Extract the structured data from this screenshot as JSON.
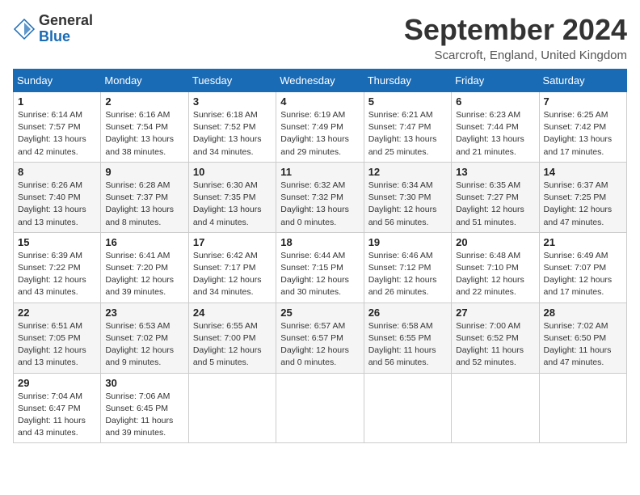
{
  "header": {
    "logo_general": "General",
    "logo_blue": "Blue",
    "month_title": "September 2024",
    "location": "Scarcroft, England, United Kingdom"
  },
  "days_of_week": [
    "Sunday",
    "Monday",
    "Tuesday",
    "Wednesday",
    "Thursday",
    "Friday",
    "Saturday"
  ],
  "weeks": [
    [
      {
        "day": "1",
        "detail": "Sunrise: 6:14 AM\nSunset: 7:57 PM\nDaylight: 13 hours\nand 42 minutes."
      },
      {
        "day": "2",
        "detail": "Sunrise: 6:16 AM\nSunset: 7:54 PM\nDaylight: 13 hours\nand 38 minutes."
      },
      {
        "day": "3",
        "detail": "Sunrise: 6:18 AM\nSunset: 7:52 PM\nDaylight: 13 hours\nand 34 minutes."
      },
      {
        "day": "4",
        "detail": "Sunrise: 6:19 AM\nSunset: 7:49 PM\nDaylight: 13 hours\nand 29 minutes."
      },
      {
        "day": "5",
        "detail": "Sunrise: 6:21 AM\nSunset: 7:47 PM\nDaylight: 13 hours\nand 25 minutes."
      },
      {
        "day": "6",
        "detail": "Sunrise: 6:23 AM\nSunset: 7:44 PM\nDaylight: 13 hours\nand 21 minutes."
      },
      {
        "day": "7",
        "detail": "Sunrise: 6:25 AM\nSunset: 7:42 PM\nDaylight: 13 hours\nand 17 minutes."
      }
    ],
    [
      {
        "day": "8",
        "detail": "Sunrise: 6:26 AM\nSunset: 7:40 PM\nDaylight: 13 hours\nand 13 minutes."
      },
      {
        "day": "9",
        "detail": "Sunrise: 6:28 AM\nSunset: 7:37 PM\nDaylight: 13 hours\nand 8 minutes."
      },
      {
        "day": "10",
        "detail": "Sunrise: 6:30 AM\nSunset: 7:35 PM\nDaylight: 13 hours\nand 4 minutes."
      },
      {
        "day": "11",
        "detail": "Sunrise: 6:32 AM\nSunset: 7:32 PM\nDaylight: 13 hours\nand 0 minutes."
      },
      {
        "day": "12",
        "detail": "Sunrise: 6:34 AM\nSunset: 7:30 PM\nDaylight: 12 hours\nand 56 minutes."
      },
      {
        "day": "13",
        "detail": "Sunrise: 6:35 AM\nSunset: 7:27 PM\nDaylight: 12 hours\nand 51 minutes."
      },
      {
        "day": "14",
        "detail": "Sunrise: 6:37 AM\nSunset: 7:25 PM\nDaylight: 12 hours\nand 47 minutes."
      }
    ],
    [
      {
        "day": "15",
        "detail": "Sunrise: 6:39 AM\nSunset: 7:22 PM\nDaylight: 12 hours\nand 43 minutes."
      },
      {
        "day": "16",
        "detail": "Sunrise: 6:41 AM\nSunset: 7:20 PM\nDaylight: 12 hours\nand 39 minutes."
      },
      {
        "day": "17",
        "detail": "Sunrise: 6:42 AM\nSunset: 7:17 PM\nDaylight: 12 hours\nand 34 minutes."
      },
      {
        "day": "18",
        "detail": "Sunrise: 6:44 AM\nSunset: 7:15 PM\nDaylight: 12 hours\nand 30 minutes."
      },
      {
        "day": "19",
        "detail": "Sunrise: 6:46 AM\nSunset: 7:12 PM\nDaylight: 12 hours\nand 26 minutes."
      },
      {
        "day": "20",
        "detail": "Sunrise: 6:48 AM\nSunset: 7:10 PM\nDaylight: 12 hours\nand 22 minutes."
      },
      {
        "day": "21",
        "detail": "Sunrise: 6:49 AM\nSunset: 7:07 PM\nDaylight: 12 hours\nand 17 minutes."
      }
    ],
    [
      {
        "day": "22",
        "detail": "Sunrise: 6:51 AM\nSunset: 7:05 PM\nDaylight: 12 hours\nand 13 minutes."
      },
      {
        "day": "23",
        "detail": "Sunrise: 6:53 AM\nSunset: 7:02 PM\nDaylight: 12 hours\nand 9 minutes."
      },
      {
        "day": "24",
        "detail": "Sunrise: 6:55 AM\nSunset: 7:00 PM\nDaylight: 12 hours\nand 5 minutes."
      },
      {
        "day": "25",
        "detail": "Sunrise: 6:57 AM\nSunset: 6:57 PM\nDaylight: 12 hours\nand 0 minutes."
      },
      {
        "day": "26",
        "detail": "Sunrise: 6:58 AM\nSunset: 6:55 PM\nDaylight: 11 hours\nand 56 minutes."
      },
      {
        "day": "27",
        "detail": "Sunrise: 7:00 AM\nSunset: 6:52 PM\nDaylight: 11 hours\nand 52 minutes."
      },
      {
        "day": "28",
        "detail": "Sunrise: 7:02 AM\nSunset: 6:50 PM\nDaylight: 11 hours\nand 47 minutes."
      }
    ],
    [
      {
        "day": "29",
        "detail": "Sunrise: 7:04 AM\nSunset: 6:47 PM\nDaylight: 11 hours\nand 43 minutes."
      },
      {
        "day": "30",
        "detail": "Sunrise: 7:06 AM\nSunset: 6:45 PM\nDaylight: 11 hours\nand 39 minutes."
      },
      null,
      null,
      null,
      null,
      null
    ]
  ]
}
